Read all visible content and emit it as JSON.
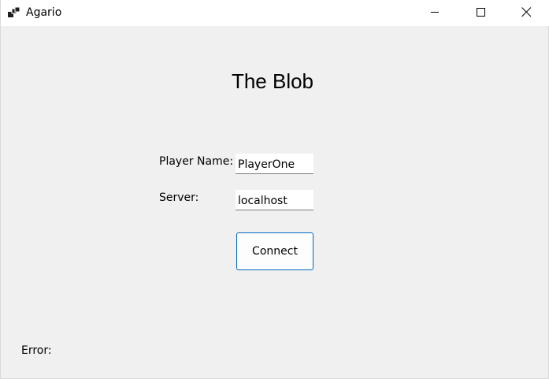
{
  "window": {
    "title": "Agario",
    "icon": "app-window-icon",
    "controls": [
      "minimize-icon",
      "maximize-icon",
      "close-icon"
    ]
  },
  "main": {
    "heading": "The Blob",
    "player_name_label": "Player Name:",
    "player_name_value": "PlayerOne",
    "server_label": "Server:",
    "server_value": "localhost",
    "connect_label": "Connect",
    "error_label": "Error:"
  },
  "colors": {
    "background": "#f0f0f0",
    "titlebar": "#ffffff",
    "accent": "#0067c0"
  }
}
